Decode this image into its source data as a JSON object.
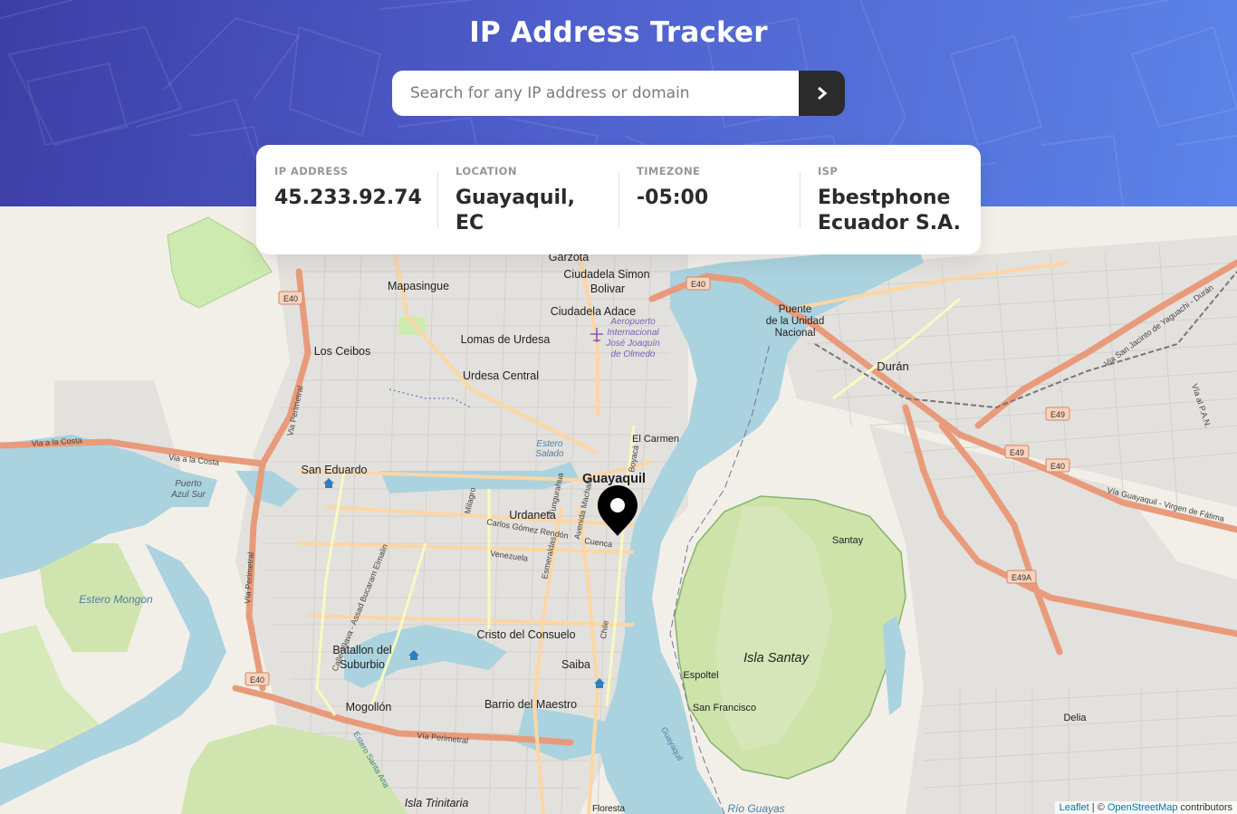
{
  "header": {
    "title": "IP Address Tracker",
    "search_placeholder": "Search for any IP address or domain",
    "search_value": ""
  },
  "info": [
    {
      "label": "IP ADDRESS",
      "value": "45.233.92.74"
    },
    {
      "label": "LOCATION",
      "value": "Guayaquil, EC"
    },
    {
      "label": "TIMEZONE",
      "value": "-05:00"
    },
    {
      "label": "ISP",
      "value": "Ebestphone Ecuador S.A."
    }
  ],
  "map": {
    "places": {
      "guayaquil": "Guayaquil",
      "duran": "Durán",
      "isla_santay": "Isla Santay",
      "mapasingue": "Mapasingue",
      "los_ceibos": "Los Ceibos",
      "lomas_urdesa": "Lomas de Urdesa",
      "urdesa_central": "Urdesa Central",
      "ciudadela_simon": "Ciudadela Simon",
      "bolivar": "Bolivar",
      "ciudadela_adace": "Ciudadela Adace",
      "garzota": "Garzota",
      "san_eduardo": "San Eduardo",
      "urdaneta": "Urdaneta",
      "el_carmen": "El Carmen",
      "puente1": "Puente",
      "puente2": "de la Unidad",
      "puente3": "Nacional",
      "santay": "Santay",
      "cristo": "Cristo del Consuelo",
      "batallon1": "Batallon del",
      "batallon2": "Suburbio",
      "saiba": "Saiba",
      "barrio": "Barrio del Maestro",
      "mogollon": "Mogollón",
      "espoltel": "Espoltel",
      "san_francisco": "San Francisco",
      "delia": "Delia",
      "isla_trinitaria": "Isla Trinitaria",
      "rio_guayas": "Río Guayas",
      "estero_mongon": "Estero Mongon",
      "puerto_azul1": "Puerto",
      "puerto_azul2": "Azul Sur",
      "estero_salado1": "Estero",
      "estero_salado2": "Salado",
      "floresta": "Floresta",
      "aeropuerto1": "Aeropuerto",
      "aeropuerto2": "Internacional",
      "aeropuerto3": "José Joaquín",
      "aeropuerto4": "de Olmedo"
    },
    "roads": {
      "via_costa": "Via a la Costa",
      "via_costa2": "Via a la Costa",
      "via_perimetral1": "Via Perimetral",
      "via_perimetral2": "Vía Perimetral",
      "via_perimetral3": "Vía Perimetral",
      "via_guayaquil": "Vía Guayaquil - Virgen de Fátima",
      "via_sanjacinto": "Via San Jacinto de Yaguachi - Durán",
      "via_pan": "Vía al P.A.N.",
      "carlos_gomez": "Carlos Gómez Rendón",
      "venezuela": "Venezuela",
      "cuenca": "Cuenca",
      "chile": "Chile",
      "esmeraldas": "Esmeraldas",
      "milagro": "Milagro",
      "tungurahua": "Tungurahua",
      "machala": "Avenida Machala",
      "boyaca": "Boyacá",
      "calle29": "Calle 29ava - Assad Bucaram Elmalin",
      "estero_santa_ana": "Estero Santa Ana",
      "guayaquil_river": "Guayaquil"
    },
    "shields": {
      "e40a": "E40",
      "e40b": "E40",
      "e40c": "E40",
      "e40d": "E40",
      "e49a": "E49",
      "e49b": "E49",
      "e49c": "E49A"
    },
    "attribution": {
      "leaflet": "Leaflet",
      "sep": " | © ",
      "osm": "OpenStreetMap",
      "suffix": " contributors"
    }
  },
  "colors": {
    "header_gradient_start": "#3d3ea5",
    "header_gradient_end": "#5c84e8",
    "water": "#aad3df",
    "land": "#f2efe9",
    "urban": "#e0dfdf",
    "park": "#cdebb0",
    "main_road": "#f6b287",
    "secondary_road": "#f7fabf",
    "marker": "#000000"
  }
}
